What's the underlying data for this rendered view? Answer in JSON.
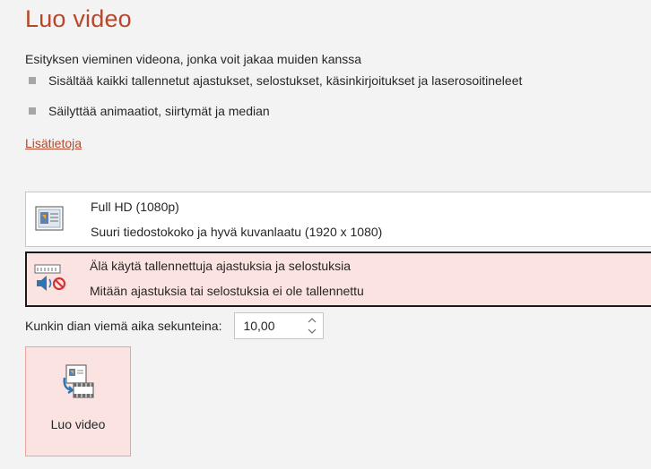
{
  "header": {
    "title": "Luo video",
    "subtitle": "Esityksen vieminen videona, jonka voit jakaa muiden kanssa"
  },
  "bullets": [
    "Sisältää kaikki tallennetut ajastukset, selostukset, käsinkirjoitukset ja laserosoitineleet",
    "Säilyttää animaatiot, siirtymät ja median"
  ],
  "link": {
    "label": "Lisätietoja"
  },
  "quality_option": {
    "title": "Full HD (1080p)",
    "description": "Suuri tiedostokoko ja hyvä kuvanlaatu (1920 x 1080)",
    "icon": "slide-quality-icon"
  },
  "timing_option": {
    "title": "Älä käytä tallennettuja ajastuksia ja selostuksia",
    "description": "Mitään ajastuksia tai selostuksia ei ole tallennettu",
    "icon": "no-narration-icon"
  },
  "seconds": {
    "label": "Kunkin dian viemä aika sekunteina:",
    "value": "10,00"
  },
  "create_button": {
    "label": "Luo video",
    "icon": "create-video-icon"
  },
  "colors": {
    "accent": "#b7472a",
    "selected_bg": "#fbe3e1",
    "background": "#f3f3f3"
  }
}
